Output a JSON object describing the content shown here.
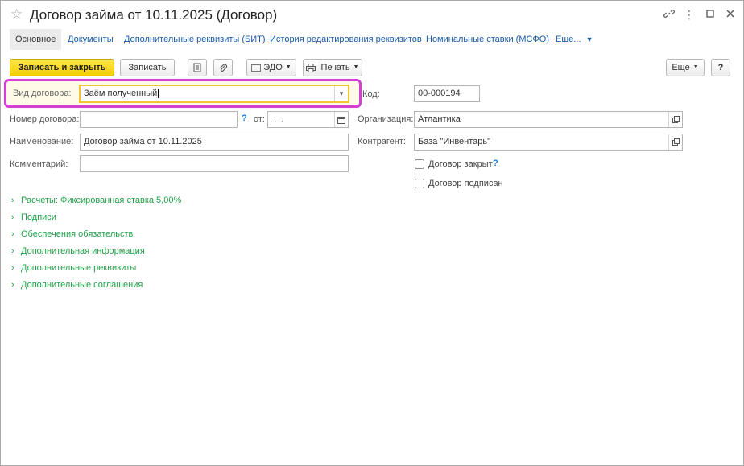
{
  "window": {
    "title": "Договор займа от 10.11.2025 (Договор)",
    "icons": [
      "star-icon",
      "link-icon",
      "more-vertical-icon",
      "maximize-icon",
      "close-icon"
    ]
  },
  "tabs": [
    {
      "label": "Основное",
      "active": true
    },
    {
      "label": "Документы"
    },
    {
      "label": "Дополнительные реквизиты (БИТ)"
    },
    {
      "label": "История редактирования реквизитов"
    },
    {
      "label": "Номинальные ставки (МСФО)"
    },
    {
      "label": "Еще..."
    }
  ],
  "toolbar": {
    "save_close": "Записать и закрыть",
    "save": "Записать",
    "edo": "ЭДО",
    "print": "Печать",
    "more": "Еще",
    "help": "?"
  },
  "form": {
    "vid_label": "Вид договора:",
    "vid_value": "Заём полученный",
    "kod_label": "Код:",
    "kod_value": "00-000194",
    "nomer_label": "Номер договора:",
    "nomer_value": "",
    "nomer_help": "?",
    "ot_label": "от:",
    "ot_value": " .  .",
    "naim_label": "Наименование:",
    "naim_value": "Договор займа от 10.11.2025",
    "komm_label": "Комментарий:",
    "komm_value": "",
    "org_label": "Организация:",
    "org_value": "Атлантика",
    "kontr_label": "Контрагент:",
    "kontr_value": "База \"Инвентарь\"",
    "closed_label": "Договор закрыт",
    "closed_help": "?",
    "signed_label": "Договор подписан",
    "closed_checked": false,
    "signed_checked": false
  },
  "groups": [
    "Расчеты: Фиксированная ставка 5,00%",
    "Подписи",
    "Обеспечения обязательств",
    "Дополнительная информация",
    "Дополнительные реквизиты",
    "Дополнительные соглашения"
  ],
  "colors": {
    "accent_link": "#1a5aa8",
    "group_green": "#21a14a",
    "primary_button": "#f5cf00",
    "highlight": "#d440d4"
  }
}
